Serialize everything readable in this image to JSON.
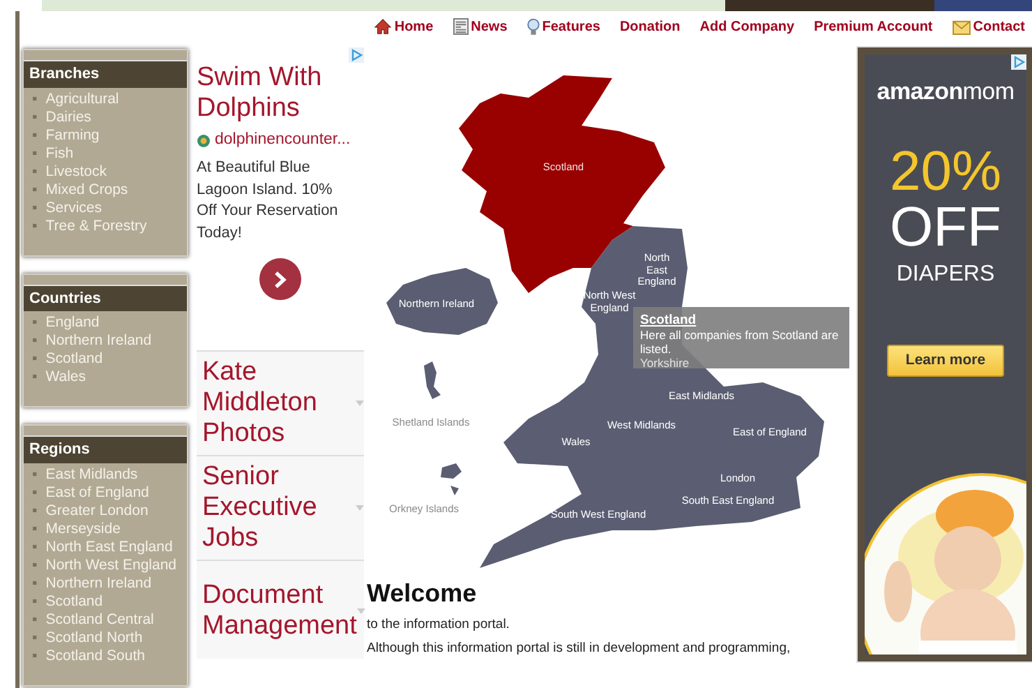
{
  "top_nav": [
    {
      "label": "Home",
      "kind": "home"
    },
    {
      "label": "News",
      "kind": "news"
    },
    {
      "label": "Features",
      "kind": "features"
    },
    {
      "label": "Donation",
      "kind": "plain"
    },
    {
      "label": "Add Company",
      "kind": "plain"
    },
    {
      "label": "Premium Account",
      "kind": "plain"
    },
    {
      "label": "Contact",
      "kind": "contact"
    }
  ],
  "sidebar": [
    {
      "title": "Branches",
      "bullet": "▪",
      "items": [
        "Agricultural",
        "Dairies",
        "Farming",
        "Fish",
        "Livestock",
        "Mixed Crops",
        "Services",
        "Tree & Forestry"
      ]
    },
    {
      "title": "Countries",
      "bullet": "▪",
      "items": [
        "England",
        "Northern Ireland",
        "Scotland",
        "Wales"
      ]
    },
    {
      "title": "Regions",
      "bullet": "▪",
      "items": [
        "East Midlands",
        "East of England",
        "Greater London",
        "Merseyside",
        "North East England",
        "North West England",
        "Northern Ireland",
        "Scotland",
        "Scotland Central",
        "Scotland North",
        "Scotland South"
      ]
    }
  ],
  "left_ad": {
    "title": "Swim With Dolphins",
    "domain": "dolphinencounter...",
    "text": "At Beautiful Blue Lagoon Island. 10% Off Your Reservation Today!",
    "links": [
      "Kate Middleton Photos",
      "Senior Executive Jobs",
      "Document Management"
    ]
  },
  "map": {
    "labels": [
      {
        "text": "Scotland",
        "kind": "red"
      },
      {
        "text": "North East England",
        "kind": "grey"
      },
      {
        "text": "Northern Ireland",
        "kind": "grey"
      },
      {
        "text": "North West England",
        "kind": "grey"
      },
      {
        "text": "Shetland Islands",
        "kind": "island"
      },
      {
        "text": "East Midlands",
        "kind": "grey"
      },
      {
        "text": "West Midlands",
        "kind": "grey"
      },
      {
        "text": "Wales",
        "kind": "grey"
      },
      {
        "text": "East of England",
        "kind": "grey"
      },
      {
        "text": "London",
        "kind": "grey"
      },
      {
        "text": "Orkney Islands",
        "kind": "island"
      },
      {
        "text": "South East England",
        "kind": "grey"
      },
      {
        "text": "South West England",
        "kind": "grey"
      }
    ],
    "tooltip": {
      "title": "Scotland",
      "text": "Here all companies from Scotland are listed.",
      "behind": "Yorkshire"
    }
  },
  "welcome": {
    "heading": "Welcome",
    "paragraphs": [
      "to the information portal.",
      "Although this information portal is still in development and programming,"
    ]
  },
  "right_ad": {
    "logo": "**amazon**mom",
    "discount": "20%",
    "off": "OFF",
    "product": "DIAPERS",
    "button": "Learn more"
  }
}
